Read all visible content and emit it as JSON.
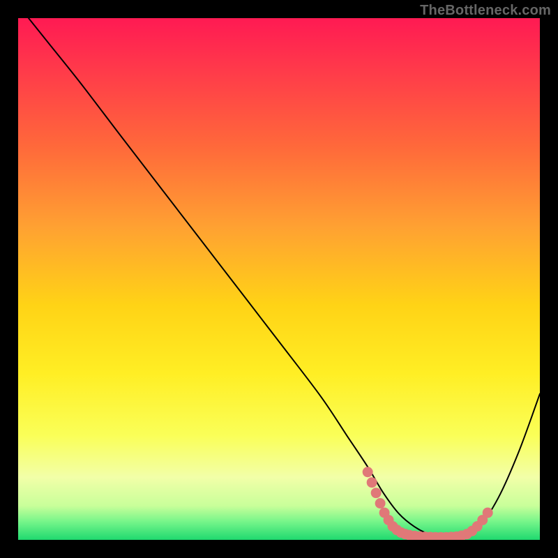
{
  "watermark": "TheBottleneck.com",
  "chart_data": {
    "type": "line",
    "title": "",
    "xlabel": "",
    "ylabel": "",
    "xlim": [
      0,
      100
    ],
    "ylim": [
      0,
      100
    ],
    "gradient_stops": [
      {
        "offset": 0.0,
        "color": "#ff1a53"
      },
      {
        "offset": 0.1,
        "color": "#ff3a4a"
      },
      {
        "offset": 0.25,
        "color": "#ff6a3a"
      },
      {
        "offset": 0.4,
        "color": "#ffa132"
      },
      {
        "offset": 0.55,
        "color": "#ffd316"
      },
      {
        "offset": 0.68,
        "color": "#ffee24"
      },
      {
        "offset": 0.8,
        "color": "#faff58"
      },
      {
        "offset": 0.88,
        "color": "#f2ffa8"
      },
      {
        "offset": 0.935,
        "color": "#c8ff9a"
      },
      {
        "offset": 0.965,
        "color": "#76f58a"
      },
      {
        "offset": 1.0,
        "color": "#1fd96f"
      }
    ],
    "series": [
      {
        "name": "bottleneck-curve",
        "color": "#000000",
        "x": [
          2,
          6,
          12,
          20,
          30,
          40,
          50,
          58,
          63,
          67,
          70,
          73,
          76,
          79,
          82,
          85,
          88,
          92,
          96,
          100
        ],
        "y": [
          100,
          95,
          87.5,
          77,
          64,
          51,
          38,
          27.5,
          20,
          14,
          9,
          5,
          2.5,
          1,
          0.5,
          0.5,
          2,
          8,
          17,
          28
        ]
      }
    ],
    "dotted_segment": {
      "color": "#e07878",
      "radius": 1.0,
      "points": [
        {
          "x": 67.0,
          "y": 13.0
        },
        {
          "x": 67.8,
          "y": 11.0
        },
        {
          "x": 68.6,
          "y": 9.0
        },
        {
          "x": 69.4,
          "y": 7.0
        },
        {
          "x": 70.2,
          "y": 5.2
        },
        {
          "x": 71.0,
          "y": 3.8
        },
        {
          "x": 71.8,
          "y": 2.6
        },
        {
          "x": 72.6,
          "y": 1.9
        },
        {
          "x": 73.4,
          "y": 1.4
        },
        {
          "x": 74.2,
          "y": 1.1
        },
        {
          "x": 75.0,
          "y": 0.9
        },
        {
          "x": 76.0,
          "y": 0.75
        },
        {
          "x": 77.0,
          "y": 0.65
        },
        {
          "x": 78.0,
          "y": 0.58
        },
        {
          "x": 79.0,
          "y": 0.53
        },
        {
          "x": 80.0,
          "y": 0.5
        },
        {
          "x": 81.0,
          "y": 0.5
        },
        {
          "x": 82.0,
          "y": 0.5
        },
        {
          "x": 83.0,
          "y": 0.55
        },
        {
          "x": 84.0,
          "y": 0.62
        },
        {
          "x": 85.0,
          "y": 0.8
        },
        {
          "x": 86.0,
          "y": 1.1
        },
        {
          "x": 87.0,
          "y": 1.7
        },
        {
          "x": 88.0,
          "y": 2.6
        },
        {
          "x": 89.0,
          "y": 3.8
        },
        {
          "x": 90.0,
          "y": 5.2
        }
      ]
    }
  }
}
